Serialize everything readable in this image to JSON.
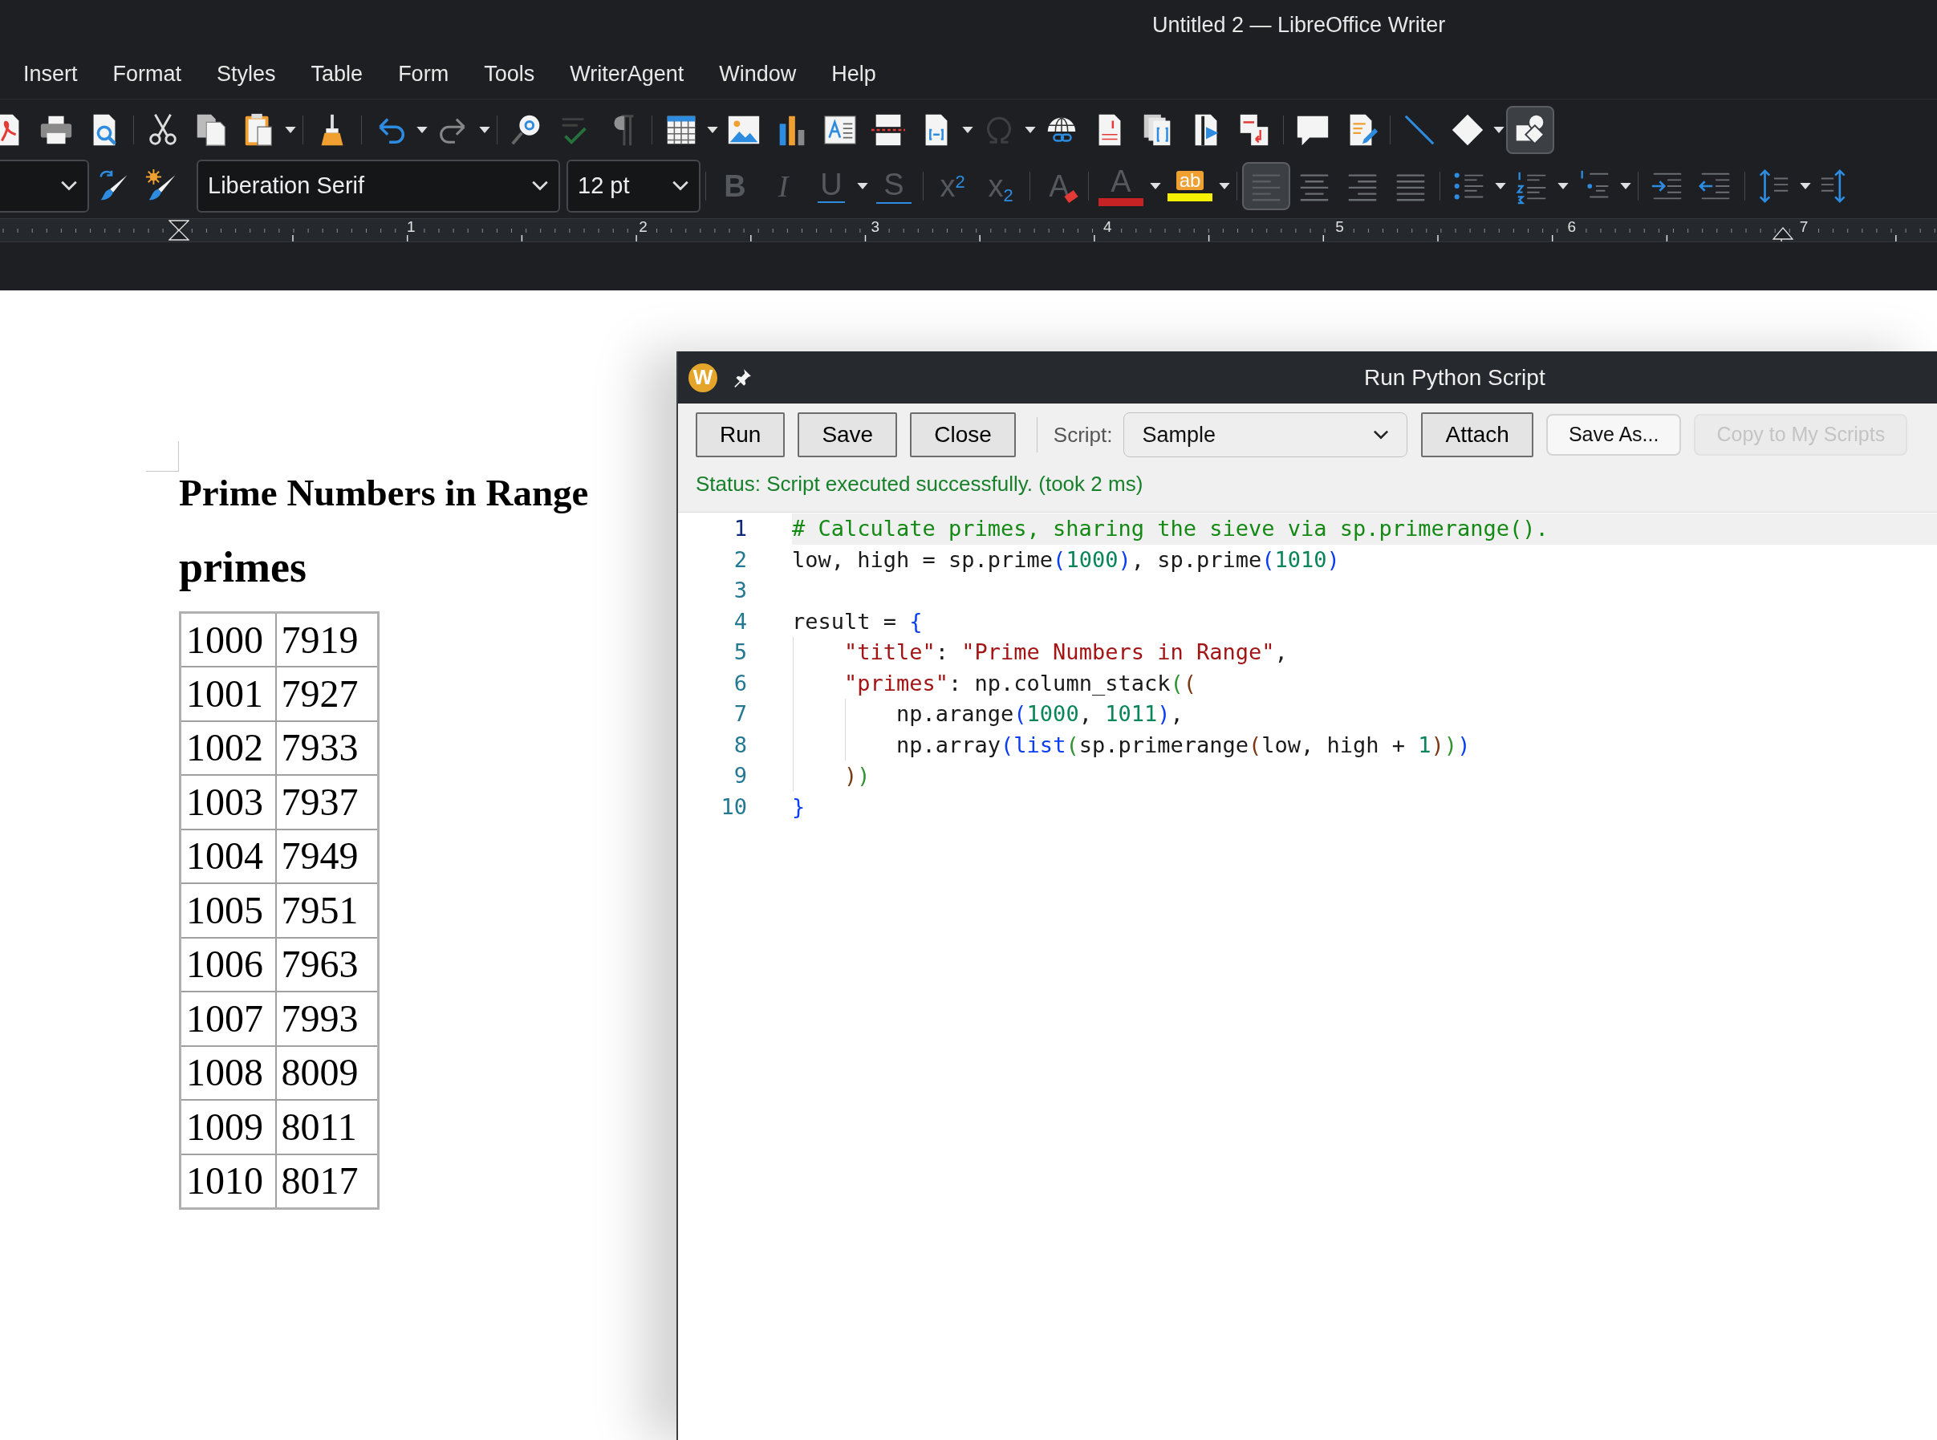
{
  "window": {
    "title": "Untitled 2 — LibreOffice Writer"
  },
  "menu": [
    "Insert",
    "Format",
    "Styles",
    "Table",
    "Form",
    "Tools",
    "WriterAgent",
    "Window",
    "Help"
  ],
  "standard_toolbar": [
    {
      "kind": "pdf",
      "dropdown": false,
      "disabled": false,
      "on": false
    },
    {
      "kind": "print",
      "dropdown": false,
      "disabled": false,
      "on": false
    },
    {
      "kind": "preview",
      "dropdown": false,
      "disabled": false,
      "on": false
    },
    {
      "kind": "separator"
    },
    {
      "kind": "cut",
      "dropdown": false,
      "disabled": false,
      "on": false
    },
    {
      "kind": "copy",
      "dropdown": false,
      "disabled": false,
      "on": false
    },
    {
      "kind": "paste",
      "dropdown": true,
      "disabled": false,
      "on": false
    },
    {
      "kind": "separator"
    },
    {
      "kind": "clone",
      "dropdown": false,
      "disabled": false,
      "on": false
    },
    {
      "kind": "separator"
    },
    {
      "kind": "undo",
      "dropdown": true,
      "disabled": false,
      "on": false
    },
    {
      "kind": "redo",
      "dropdown": true,
      "disabled": true,
      "on": false
    },
    {
      "kind": "separator"
    },
    {
      "kind": "find",
      "dropdown": false,
      "disabled": false,
      "on": false
    },
    {
      "kind": "spelling",
      "dropdown": false,
      "disabled": true,
      "on": false
    },
    {
      "kind": "marks",
      "dropdown": false,
      "disabled": true,
      "on": false
    },
    {
      "kind": "separator"
    },
    {
      "kind": "table",
      "dropdown": true,
      "disabled": false,
      "on": false
    },
    {
      "kind": "image",
      "dropdown": false,
      "disabled": false,
      "on": false
    },
    {
      "kind": "chart",
      "dropdown": false,
      "disabled": false,
      "on": false
    },
    {
      "kind": "textbox",
      "dropdown": false,
      "disabled": false,
      "on": false
    },
    {
      "kind": "pagebreak",
      "dropdown": false,
      "disabled": false,
      "on": false
    },
    {
      "kind": "field",
      "dropdown": true,
      "disabled": false,
      "on": false
    },
    {
      "kind": "special",
      "dropdown": true,
      "disabled": true,
      "on": false
    },
    {
      "kind": "hyperlink",
      "dropdown": false,
      "disabled": false,
      "on": false
    },
    {
      "kind": "footnote",
      "dropdown": false,
      "disabled": false,
      "on": false
    },
    {
      "kind": "index",
      "dropdown": false,
      "disabled": false,
      "on": false
    },
    {
      "kind": "bookmark",
      "dropdown": false,
      "disabled": false,
      "on": false
    },
    {
      "kind": "crossref",
      "dropdown": false,
      "disabled": false,
      "on": false
    },
    {
      "kind": "separator"
    },
    {
      "kind": "comment",
      "dropdown": false,
      "disabled": false,
      "on": false
    },
    {
      "kind": "track",
      "dropdown": false,
      "disabled": false,
      "on": false
    },
    {
      "kind": "separator"
    },
    {
      "kind": "line",
      "dropdown": false,
      "disabled": false,
      "on": false
    },
    {
      "kind": "shape",
      "dropdown": true,
      "disabled": false,
      "on": false
    },
    {
      "kind": "draw",
      "dropdown": false,
      "disabled": false,
      "on": true
    }
  ],
  "formatting_toolbar": [
    {
      "kind": "style_combo"
    },
    {
      "kind": "update_style",
      "dropdown": false,
      "disabled": false,
      "on": false
    },
    {
      "kind": "new_style",
      "dropdown": false,
      "disabled": false,
      "on": false
    },
    {
      "kind": "font_combo",
      "value": "Liberation Serif"
    },
    {
      "kind": "size_combo",
      "value": "12 pt"
    },
    {
      "kind": "separator"
    },
    {
      "kind": "bold",
      "glyph": "B",
      "dropdown": false,
      "disabled": true,
      "on": false
    },
    {
      "kind": "italic",
      "glyph": "I",
      "dropdown": false,
      "disabled": true,
      "on": false
    },
    {
      "kind": "underline",
      "glyph": "U",
      "dropdown": true,
      "disabled": true,
      "on": false
    },
    {
      "kind": "strike",
      "glyph": "S",
      "dropdown": false,
      "disabled": true,
      "on": false
    },
    {
      "kind": "separator"
    },
    {
      "kind": "superscript",
      "glyph": "x$^{2}$",
      "dropdown": false,
      "disabled": true,
      "on": false
    },
    {
      "kind": "subscript",
      "glyph": "x$_{2}$",
      "dropdown": false,
      "disabled": true,
      "on": false
    },
    {
      "kind": "separator"
    },
    {
      "kind": "clear",
      "glyph": "A",
      "dropdown": false,
      "disabled": true,
      "on": false
    },
    {
      "kind": "separator"
    },
    {
      "kind": "fontcolor",
      "glyph": "A",
      "dropdown": true,
      "disabled": true,
      "on": false
    },
    {
      "kind": "highlight",
      "glyph": "ab",
      "dropdown": true,
      "disabled": false,
      "on": false
    },
    {
      "kind": "separator"
    },
    {
      "kind": "align_left",
      "dropdown": false,
      "disabled": false,
      "on": true
    },
    {
      "kind": "align_center",
      "dropdown": false,
      "disabled": false,
      "on": false
    },
    {
      "kind": "align_right",
      "dropdown": false,
      "disabled": false,
      "on": false
    },
    {
      "kind": "justify",
      "dropdown": false,
      "disabled": false,
      "on": false
    },
    {
      "kind": "separator"
    },
    {
      "kind": "bullets",
      "dropdown": true,
      "disabled": false,
      "on": false
    },
    {
      "kind": "numbering",
      "dropdown": true,
      "disabled": false,
      "on": false
    },
    {
      "kind": "outline",
      "dropdown": true,
      "disabled": false,
      "on": false
    },
    {
      "kind": "separator"
    },
    {
      "kind": "indent",
      "dropdown": false,
      "disabled": false,
      "on": false
    },
    {
      "kind": "outdent",
      "dropdown": false,
      "disabled": false,
      "on": false
    },
    {
      "kind": "separator"
    },
    {
      "kind": "linespacing",
      "dropdown": true,
      "disabled": false,
      "on": false
    },
    {
      "kind": "paraspacing",
      "dropdown": false,
      "disabled": false,
      "on": false
    }
  ],
  "ruler": {
    "labels": [
      "1",
      "2",
      "3",
      "4",
      "5",
      "6",
      "7"
    ]
  },
  "document": {
    "heading": "Prime Numbers in Range",
    "subheading": "primes",
    "table": [
      [
        "1000",
        "7919"
      ],
      [
        "1001",
        "7927"
      ],
      [
        "1002",
        "7933"
      ],
      [
        "1003",
        "7937"
      ],
      [
        "1004",
        "7949"
      ],
      [
        "1005",
        "7951"
      ],
      [
        "1006",
        "7963"
      ],
      [
        "1007",
        "7993"
      ],
      [
        "1008",
        "8009"
      ],
      [
        "1009",
        "8011"
      ],
      [
        "1010",
        "8017"
      ]
    ]
  },
  "dialog": {
    "badge": "W",
    "title": "Run Python Script",
    "buttons": [
      {
        "label": "Run",
        "kind": "push",
        "disabled": false
      },
      {
        "label": "Save",
        "kind": "push",
        "disabled": false
      },
      {
        "label": "Close",
        "kind": "push",
        "disabled": false
      },
      {
        "kind": "divider"
      },
      {
        "kind": "script_picker",
        "label": "Script:",
        "value": "Sample"
      },
      {
        "label": "Attach",
        "kind": "push",
        "disabled": false
      },
      {
        "label": "Save As...",
        "kind": "flat",
        "disabled": false
      },
      {
        "label": "Copy to My Scripts",
        "kind": "flat",
        "disabled": true
      }
    ],
    "status": "Status: Script executed successfully. (took 2 ms)",
    "code": [
      {
        "number": "1",
        "current": true,
        "tokens": [
          {
            "t": "# Calculate primes, sharing the sieve via sp.primerange().",
            "kind": "comment"
          }
        ]
      },
      {
        "number": "2",
        "current": false,
        "tokens": [
          {
            "t": "low, high = sp.prime",
            "kind": "plain"
          },
          {
            "t": "(",
            "kind": "p1"
          },
          {
            "t": "1000",
            "kind": "num"
          },
          {
            "t": ")",
            "kind": "p1"
          },
          {
            "t": ", sp.prime",
            "kind": "plain"
          },
          {
            "t": "(",
            "kind": "p1"
          },
          {
            "t": "1010",
            "kind": "num"
          },
          {
            "t": ")",
            "kind": "p1"
          }
        ]
      },
      {
        "number": "3",
        "current": false
      },
      {
        "number": "4",
        "current": false,
        "tokens": [
          {
            "t": "result = ",
            "kind": "plain"
          },
          {
            "t": "{",
            "kind": "p1"
          }
        ]
      },
      {
        "number": "5",
        "current": false,
        "tokens": [
          {
            "t": "    \"title\"",
            "kind": "str"
          },
          {
            "t": ": ",
            "kind": "plain"
          },
          {
            "t": "\"Prime Numbers in Range\"",
            "kind": "str"
          },
          {
            "t": ",",
            "kind": "plain"
          }
        ]
      },
      {
        "number": "6",
        "current": false,
        "tokens": [
          {
            "t": "    \"primes\"",
            "kind": "str"
          },
          {
            "t": ": np.column_stack",
            "kind": "plain"
          },
          {
            "t": "(",
            "kind": "p2"
          },
          {
            "t": "(",
            "kind": "p3"
          }
        ]
      },
      {
        "number": "7",
        "current": false,
        "tokens": [
          {
            "t": "        np.arange",
            "kind": "plain"
          },
          {
            "t": "(",
            "kind": "p1"
          },
          {
            "t": "1000",
            "kind": "num"
          },
          {
            "t": ", ",
            "kind": "plain"
          },
          {
            "t": "1011",
            "kind": "num"
          },
          {
            "t": ")",
            "kind": "p1"
          },
          {
            "t": ",",
            "kind": "plain"
          }
        ]
      },
      {
        "number": "8",
        "current": false,
        "tokens": [
          {
            "t": "        np.array",
            "kind": "plain"
          },
          {
            "t": "(",
            "kind": "p1"
          },
          {
            "t": "list",
            "kind": "builtin"
          },
          {
            "t": "(",
            "kind": "p2"
          },
          {
            "t": "sp.primerange",
            "kind": "plain"
          },
          {
            "t": "(",
            "kind": "p3"
          },
          {
            "t": "low, high + ",
            "kind": "plain"
          },
          {
            "t": "1",
            "kind": "num"
          },
          {
            "t": ")",
            "kind": "p3"
          },
          {
            "t": ")",
            "kind": "p2"
          },
          {
            "t": ")",
            "kind": "p1"
          }
        ]
      },
      {
        "number": "9",
        "current": false,
        "tokens": [
          {
            "t": "    )",
            "kind": "p3"
          },
          {
            "t": ")",
            "kind": "p2"
          }
        ]
      },
      {
        "number": "10",
        "current": false,
        "tokens": [
          {
            "t": "}",
            "kind": "p1"
          }
        ]
      }
    ]
  }
}
